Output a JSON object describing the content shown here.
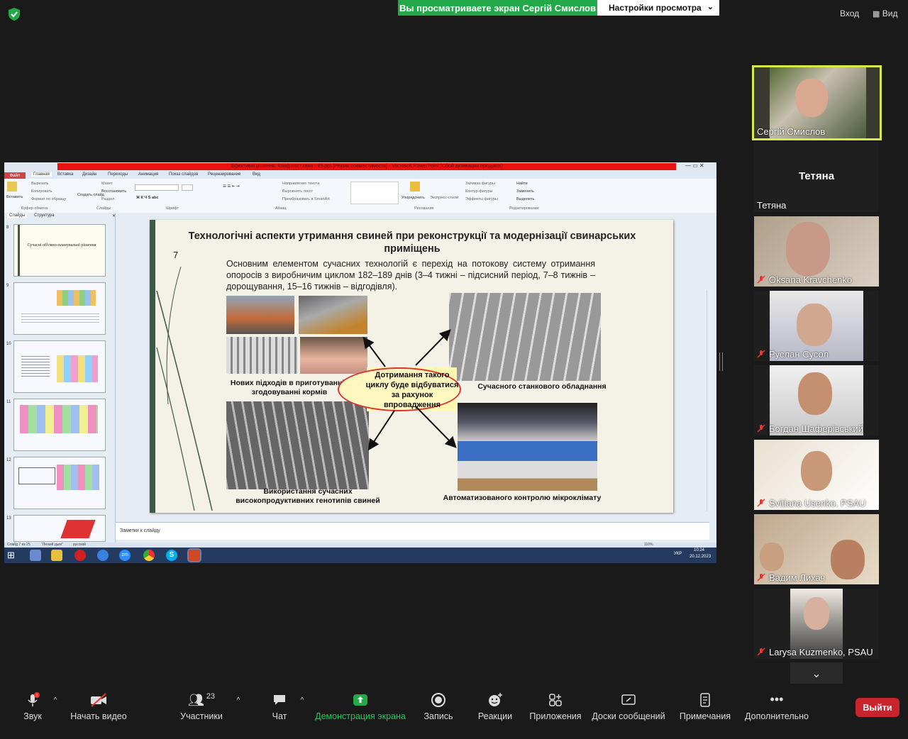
{
  "top_bar": {
    "share_banner": "Вы просматриваете экран Сергій Смислов",
    "view_options": "Настройки просмотра",
    "exit_label": "Вход",
    "view_label": "Вид"
  },
  "ppt": {
    "window_title": "Ефективні рішення. Конф.пост.свин - 85.ppt [Режим совместимости] - Microsoft PowerPoint (Сбой активации продукта)",
    "tabs": [
      "Файл",
      "Главная",
      "Вставка",
      "Дизайн",
      "Переходы",
      "Анимация",
      "Показ слайдов",
      "Рецензирование",
      "Вид"
    ],
    "ribbon": {
      "paste": "Вставить",
      "cut": "Вырезать",
      "copy": "Копировать",
      "format_painter": "Формат по образцу",
      "clipboard": "Буфер обмена",
      "new_slide": "Создать слайд",
      "layout": "Макет",
      "reset": "Восстановить",
      "section": "Раздел",
      "slides": "Слайды",
      "font": "Шрифт",
      "paragraph": "Абзац",
      "text_direction": "Направление текста",
      "align_text": "Выровнять текст",
      "smartart": "Преобразовать в SmartArt",
      "arrange": "Упорядочить",
      "quick_styles": "Экспресс-стили",
      "shape_fill": "Заливка фигуры",
      "shape_outline": "Контур фигуры",
      "shape_effects": "Эффекты фигуры",
      "drawing": "Рисование",
      "find": "Найти",
      "replace": "Заменить",
      "select": "Выделить",
      "editing": "Редактирование"
    },
    "pane_tabs": [
      "Слайды",
      "Структура"
    ],
    "thumbnails": [
      {
        "num": "8",
        "text": "Сучасні об'ємно-планувальні рішення"
      },
      {
        "num": "9",
        "text": ""
      },
      {
        "num": "10",
        "text": ""
      },
      {
        "num": "11",
        "text": ""
      },
      {
        "num": "12",
        "text": ""
      },
      {
        "num": "13",
        "text": ""
      }
    ],
    "notes_placeholder": "Заметки к слайду",
    "status": {
      "slide_of": "Слайд 7 из 25",
      "theme": "\"Легкий дым\"",
      "lang": "русский",
      "zoom": "110%"
    }
  },
  "slide": {
    "number": "7",
    "title": "Технологічні аспекти утримання свиней при реконструкції та модернізації свинарських приміщень",
    "body": "Основним елементом сучасних технологій є перехід на потокову систему отримання опоросів з виробничим циклом 182–189 днів (3–4 тижні – підсисний період, 7–8 тижнів – дорощування, 15–16 тижнів – відгодівля).",
    "center_text": "Дотримання такого циклу буде відбуватися за рахунок впровадження",
    "caption_feed": "Нових підходів в приготуванні і згодовуванні кормів",
    "caption_stalls": "Сучасного станкового обладнання",
    "caption_genotypes": "Використання сучасних високопродуктивних генотипів свиней",
    "caption_climate": "Автоматизованого контролю мікроклімату"
  },
  "taskbar": {
    "lang": "УКР",
    "time": "10:24",
    "date": "20.12.2023"
  },
  "participants": [
    {
      "name": "Сергій Смислов",
      "muted": false
    },
    {
      "name": "Тетяна",
      "big_name": "Тетяна",
      "muted": false
    },
    {
      "name": "Oksana Kravchenko",
      "muted": true
    },
    {
      "name": "Руслан Сусол",
      "muted": true
    },
    {
      "name": "Богдан Шаферівський",
      "muted": true
    },
    {
      "name": "Svitlana Usenko. PSAU",
      "muted": true
    },
    {
      "name": "Вадим Лихач",
      "muted": true
    },
    {
      "name": "Larysa Kuzmenko, PSAU",
      "muted": true
    }
  ],
  "toolbar": {
    "audio": "Звук",
    "video": "Начать видео",
    "participants": "Участники",
    "participants_count": "23",
    "chat": "Чат",
    "share": "Демонстрация экрана",
    "record": "Запись",
    "reactions": "Реакции",
    "apps": "Приложения",
    "whiteboards": "Доски сообщений",
    "notes": "Примечания",
    "more": "Дополнительно",
    "leave": "Выйти"
  },
  "colors": {
    "share_green": "#23a94a",
    "leave_red": "#c9242b",
    "active_speaker": "#d7e84a",
    "slide_accent": "#3e5a45"
  }
}
